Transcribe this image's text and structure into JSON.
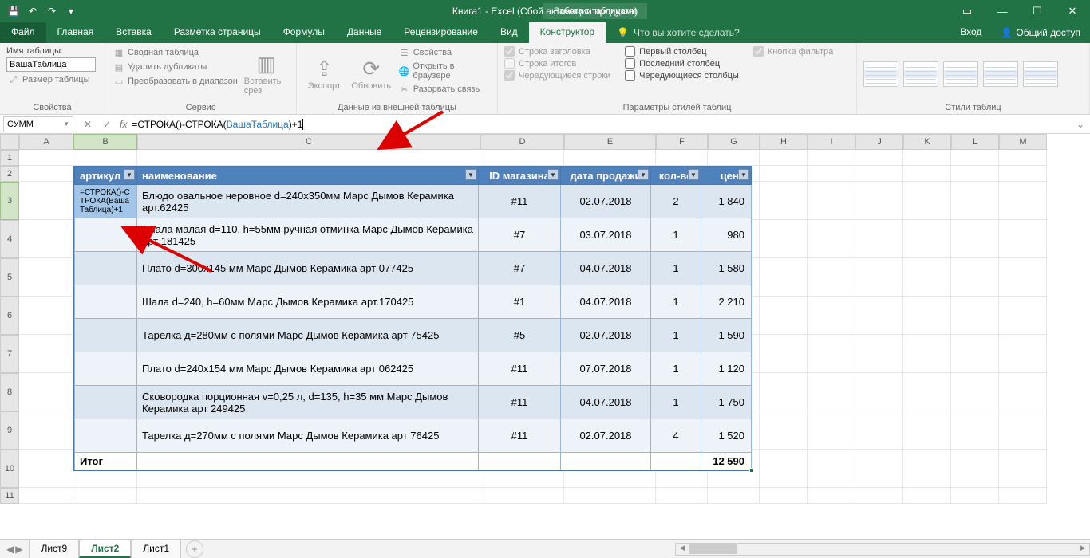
{
  "app": {
    "title": "Книга1 - Excel (Сбой активации продукта)",
    "context_tab": "Работа с таблицами"
  },
  "qat": {
    "save": "💾",
    "undo": "↶",
    "redo": "↷",
    "more": "▾"
  },
  "wincontrols": {
    "ribbonopts": "▭",
    "min": "—",
    "max": "☐",
    "close": "✕"
  },
  "tabs": [
    "Файл",
    "Главная",
    "Вставка",
    "Разметка страницы",
    "Формулы",
    "Данные",
    "Рецензирование",
    "Вид",
    "Конструктор"
  ],
  "tellme": "Что вы хотите сделать?",
  "acct": {
    "signin": "Вход",
    "share": "Общий доступ"
  },
  "ribbon": {
    "g1": {
      "label": "Свойства",
      "namelabel": "Имя таблицы:",
      "tablename": "ВашаТаблица",
      "resize": "Размер таблицы"
    },
    "g2": {
      "label": "Сервис",
      "pivot": "Сводная таблица",
      "dupes": "Удалить дубликаты",
      "range": "Преобразовать в диапазон",
      "slicer": "Вставить срез"
    },
    "g3": {
      "label": "Данные из внешней таблицы",
      "export": "Экспорт",
      "refresh": "Обновить",
      "props": "Свойства",
      "browser": "Открыть в браузере",
      "unlink": "Разорвать связь"
    },
    "g4": {
      "label": "Параметры стилей таблиц",
      "header": "Строка заголовка",
      "total": "Строка итогов",
      "banded": "Чередующиеся строки",
      "firstcol": "Первый столбец",
      "lastcol": "Последний столбец",
      "bandedcol": "Чередующиеся столбцы",
      "filterbtn": "Кнопка фильтра"
    },
    "g5": {
      "label": "Стили таблиц"
    }
  },
  "fbar": {
    "name": "СУММ",
    "formula_pre": "=СТРОКА()-СТРОКА(",
    "formula_ref": "ВашаТаблица",
    "formula_post": ")+1"
  },
  "columns": [
    "A",
    "B",
    "C",
    "D",
    "E",
    "F",
    "G",
    "H",
    "I",
    "J",
    "K",
    "L",
    "M"
  ],
  "rows": [
    "1",
    "2",
    "3",
    "4",
    "5",
    "6",
    "7",
    "8",
    "9",
    "10",
    "11"
  ],
  "table": {
    "headers": {
      "art": "артикул",
      "name": "наименование",
      "id": "ID магазина",
      "date": "дата продажи",
      "qty": "кол-во",
      "price": "цена"
    },
    "editcell": "=СТРОКА()-СТРОКА(ВашаТаблица)+1",
    "rows": [
      {
        "name": "Блюдо овальное неровное d=240х350мм Марс Дымов Керамика арт.62425",
        "id": "#11",
        "date": "02.07.2018",
        "qty": "2",
        "price": "1 840"
      },
      {
        "name": "Пиала малая d=110, h=55мм ручная отминка Марс Дымов Керамика арт 181425",
        "id": "#7",
        "date": "03.07.2018",
        "qty": "1",
        "price": "980"
      },
      {
        "name": "Плато d=300х145 мм Марс Дымов Керамика арт 077425",
        "id": "#7",
        "date": "04.07.2018",
        "qty": "1",
        "price": "1 580"
      },
      {
        "name": "Шала d=240, h=60мм  Марс Дымов Керамика арт.170425",
        "id": "#1",
        "date": "04.07.2018",
        "qty": "1",
        "price": "2 210"
      },
      {
        "name": "Тарелка д=280мм с полями Марс Дымов Керамика арт 75425",
        "id": "#5",
        "date": "02.07.2018",
        "qty": "1",
        "price": "1 590"
      },
      {
        "name": "Плато d=240х154 мм Марс Дымов Керамика арт 062425",
        "id": "#11",
        "date": "07.07.2018",
        "qty": "1",
        "price": "1 120"
      },
      {
        "name": "Сковородка порционная v=0,25 л, d=135, h=35 мм Марс Дымов Керамика арт 249425",
        "id": "#11",
        "date": "04.07.2018",
        "qty": "1",
        "price": "1 750"
      },
      {
        "name": "Тарелка д=270мм с полями Марс Дымов Керамика арт 76425",
        "id": "#11",
        "date": "02.07.2018",
        "qty": "4",
        "price": "1 520"
      }
    ],
    "total_label": "Итог",
    "total_value": "12 590"
  },
  "sheets": {
    "tabs": [
      "Лист9",
      "Лист2",
      "Лист1"
    ],
    "active": "Лист2"
  }
}
